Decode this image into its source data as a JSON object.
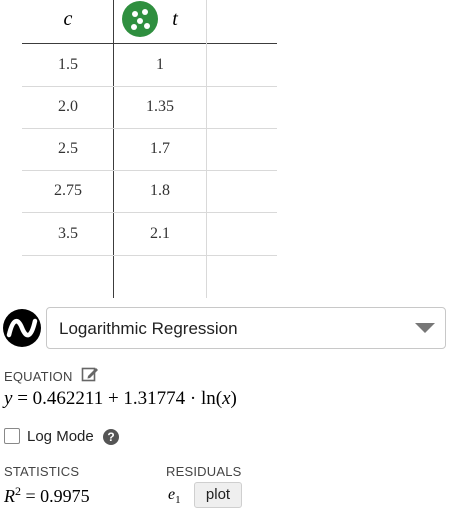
{
  "table": {
    "columns": [
      {
        "header": "c",
        "values": [
          "1.5",
          "2.0",
          "2.5",
          "2.75",
          "3.5"
        ]
      },
      {
        "header": "t",
        "values": [
          "1",
          "1.35",
          "1.7",
          "1.8",
          "2.1"
        ]
      }
    ],
    "column_icon": "point-dots-icon",
    "column_icon_color": "#2f8f3f"
  },
  "regression": {
    "model_label": "Logarithmic Regression",
    "logo_icon": "desmos-logo-icon"
  },
  "equation": {
    "section_label": "EQUATION",
    "y": "y",
    "equals": " = ",
    "a": "0.462211",
    "plus": " + ",
    "b": "1.31774",
    "dot": " · ",
    "func": "ln",
    "arg_open": "(",
    "arg": "x",
    "arg_close": ")"
  },
  "log_mode": {
    "label": "Log Mode",
    "checked": false,
    "help_glyph": "?"
  },
  "statistics": {
    "section_label": "STATISTICS",
    "r": "R",
    "r_exp": "2",
    "equals": " = ",
    "value": "0.9975"
  },
  "residuals": {
    "section_label": "RESIDUALS",
    "e": "e",
    "e_sub": "1",
    "plot_label": "plot"
  }
}
